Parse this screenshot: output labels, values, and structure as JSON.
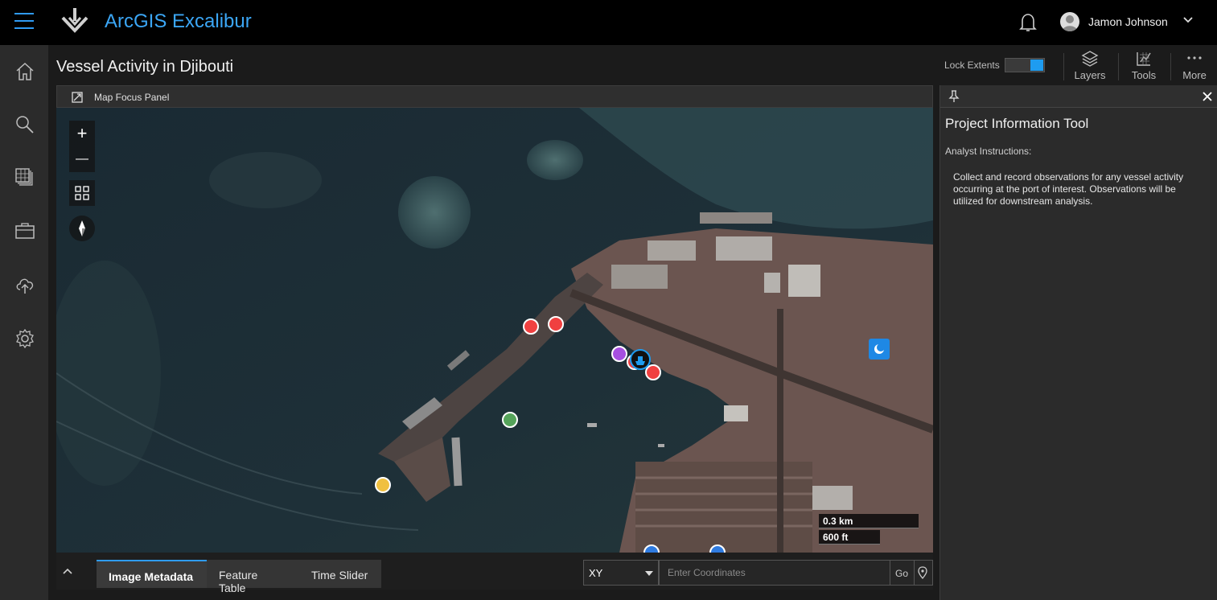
{
  "app": {
    "title": "ArcGIS Excalibur"
  },
  "user": {
    "name": "Jamon Johnson"
  },
  "nav": {
    "items": [
      "home-icon",
      "search-icon",
      "image-stack-icon",
      "briefcase-icon",
      "upload-cloud-icon",
      "gear-icon"
    ]
  },
  "page": {
    "title": "Vessel Activity in Djibouti"
  },
  "toolbar": {
    "lock_extents_label": "Lock Extents",
    "lock_extents_on": true,
    "layers_label": "Layers",
    "tools_label": "Tools",
    "more_label": "More"
  },
  "map": {
    "panel_label": "Map Focus Panel",
    "zoom_in": "+",
    "zoom_out": "—",
    "scale_km": "0.3 km",
    "scale_ft": "600 ft",
    "marker_colors": {
      "red": "#f04040",
      "purple": "#a64fe0",
      "green": "#55a35a",
      "yellow": "#f0c040",
      "blue": "#2f7be0"
    }
  },
  "bottom": {
    "tabs": [
      "Image Metadata",
      "Feature Table",
      "Time Slider"
    ],
    "active_tab": "Image Metadata",
    "coord_system": "XY",
    "coord_placeholder": "Enter Coordinates",
    "go_label": "Go"
  },
  "panel": {
    "title": "Project Information Tool",
    "subtitle": "Analyst Instructions:",
    "instructions": "Collect and record observations for any vessel activity occurring at the port of interest. Observations will be utilized for downstream analysis."
  },
  "colors": {
    "accent": "#2f9bf5",
    "topbar": "#000000",
    "panel": "#2b2b2b"
  }
}
